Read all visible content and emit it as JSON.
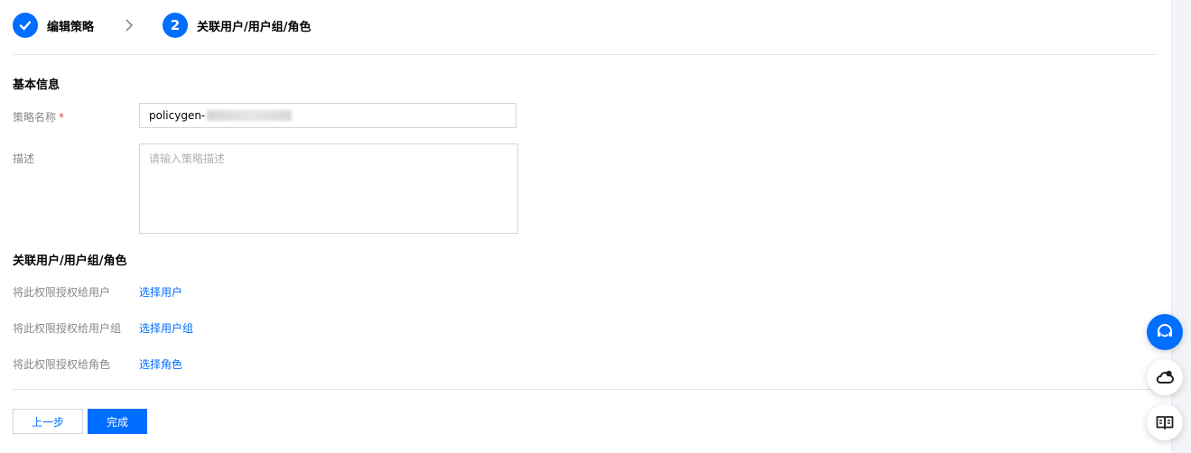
{
  "steps": [
    {
      "label": "编辑策略",
      "state": "done"
    },
    {
      "label": "关联用户/用户组/角色",
      "state": "active",
      "number": "2"
    }
  ],
  "basic_info": {
    "title": "基本信息",
    "name_label": "策略名称",
    "required_mark": "*",
    "name_value": "policygen-",
    "desc_label": "描述",
    "desc_placeholder": "请输入策略描述"
  },
  "association": {
    "title": "关联用户/用户组/角色",
    "rows": [
      {
        "label": "将此权限授权给用户",
        "link": "选择用户"
      },
      {
        "label": "将此权限授权给用户组",
        "link": "选择用户组"
      },
      {
        "label": "将此权限授权给角色",
        "link": "选择角色"
      }
    ]
  },
  "buttons": {
    "prev": "上一步",
    "done": "完成"
  },
  "float_actions": [
    "headset-icon",
    "cloud-chat-icon",
    "book-icon"
  ],
  "colors": {
    "primary": "#006eff",
    "required": "#e54545"
  }
}
